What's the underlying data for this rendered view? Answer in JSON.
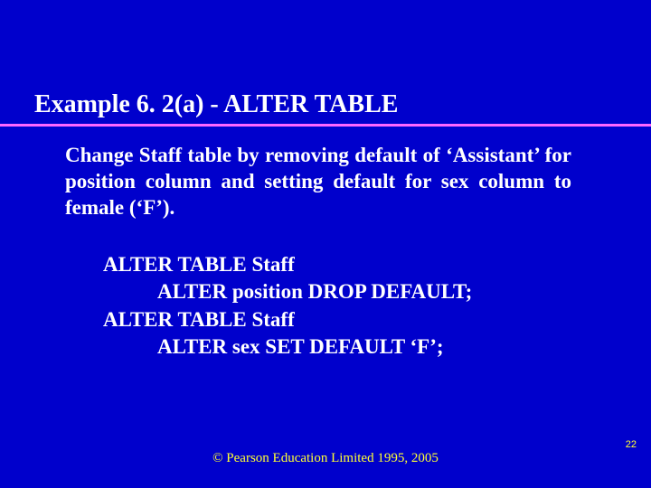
{
  "title": "Example 6. 2(a) - ALTER TABLE",
  "body": "Change Staff table by removing default of ‘Assistant’ for position column and setting default for sex column to female (‘F’).",
  "code": {
    "l1": "ALTER TABLE Staff",
    "l2": "ALTER position DROP DEFAULT;",
    "l3": "ALTER TABLE Staff",
    "l4": "ALTER sex SET DEFAULT ‘F’;"
  },
  "footer": "© Pearson Education Limited 1995, 2005",
  "page": "22"
}
